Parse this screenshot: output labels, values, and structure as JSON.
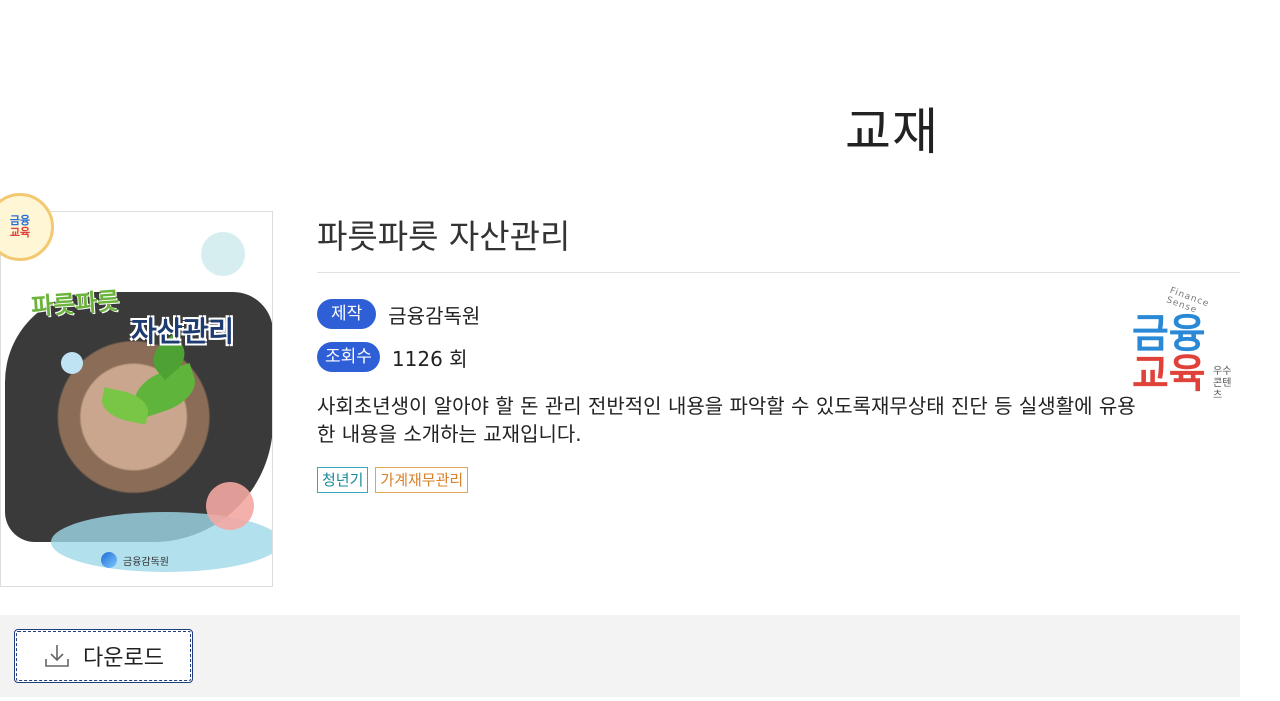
{
  "page": {
    "title": "교재"
  },
  "cover": {
    "title_line1": "파릇파릇",
    "title_line2": "자산관리",
    "publisher": "금융감독원",
    "seal_top": "금융",
    "seal_bottom": "교육"
  },
  "book": {
    "title": "파릇파릇 자산관리",
    "producer_label": "제작",
    "producer_value": "금융감독원",
    "views_label": "조회수",
    "views_value": "1126 회",
    "description": "사회초년생이 알아야 할 돈 관리 전반적인 내용을 파악할 수 있도록재무상태 진단 등 실생활에 유용한 내용을 소개하는 교재입니다.",
    "tags": [
      "청년기",
      "가계재무관리"
    ]
  },
  "logo": {
    "arc_text": "Finance Sense",
    "line1": "금융",
    "line2": "교육",
    "sub_line1": "우수",
    "sub_line2": "콘텐츠"
  },
  "actions": {
    "download_label": "다운로드"
  },
  "colors": {
    "accent": "#2f5fd6",
    "tag_teal": "#3aa7b5",
    "tag_orange": "#e3a25a"
  }
}
